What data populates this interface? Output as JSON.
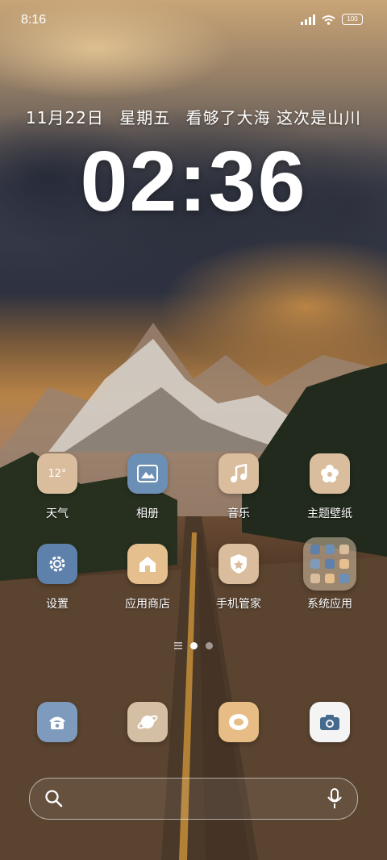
{
  "status": {
    "time": "8:16",
    "battery": "100"
  },
  "lockline": {
    "date": "11月22日",
    "weekday": "星期五",
    "motto": "看够了大海 这次是山川"
  },
  "clock": {
    "time": "02:36"
  },
  "apps": [
    {
      "label": "天气",
      "tile_text": "12°",
      "color": "#d9bd9c",
      "icon": "weather-icon"
    },
    {
      "label": "相册",
      "color": "#6c8fb5",
      "icon": "gallery-icon"
    },
    {
      "label": "音乐",
      "color": "#d9bd9c",
      "icon": "music-icon"
    },
    {
      "label": "主题壁纸",
      "color": "#d9bd9c",
      "icon": "theme-icon"
    },
    {
      "label": "设置",
      "color": "#5d81ab",
      "icon": "settings-icon"
    },
    {
      "label": "应用商店",
      "color": "#e6bf8e",
      "icon": "store-icon"
    },
    {
      "label": "手机管家",
      "color": "#d9bd9c",
      "icon": "security-icon"
    },
    {
      "label": "系统应用",
      "color": "#d4bfa5",
      "icon": "folder-icon"
    }
  ],
  "dock": [
    {
      "icon": "phone-icon",
      "color": "#7e9bbd"
    },
    {
      "icon": "browser-icon",
      "color": "#d4bfa5"
    },
    {
      "icon": "messages-icon",
      "color": "#e8bd85"
    },
    {
      "icon": "camera-icon",
      "color": "#f4f4f4"
    }
  ],
  "pager": {
    "current": 1,
    "pages": 2
  }
}
